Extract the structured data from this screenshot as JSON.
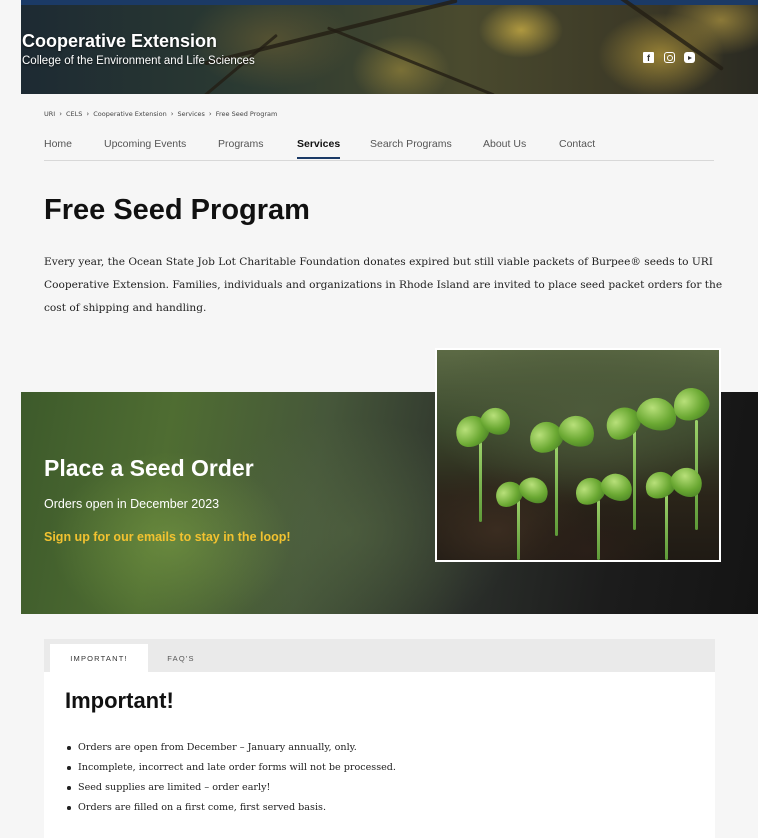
{
  "header": {
    "title": "Cooperative Extension",
    "subtitle": "College of the Environment and Life Sciences",
    "social_icons": [
      "facebook-icon",
      "instagram-icon",
      "youtube-icon"
    ]
  },
  "breadcrumb": [
    "URI",
    "CELS",
    "Cooperative Extension",
    "Services",
    "Free Seed Program"
  ],
  "nav": {
    "items": [
      "Home",
      "Upcoming Events",
      "Programs",
      "Services",
      "Search Programs",
      "About Us",
      "Contact"
    ],
    "active": "Services"
  },
  "page": {
    "title": "Free Seed Program",
    "intro": "Every year, the Ocean State Job Lot Charitable Foundation donates expired but still viable packets of Burpee® seeds to URI Cooperative Extension. Families, individuals and organizations in Rhode Island are invited to place seed packet orders for the cost of shipping and handling."
  },
  "seed_order": {
    "title": "Place a Seed Order",
    "subtitle": "Orders open in December 2023",
    "link": "Sign up for our emails to stay in the loop!"
  },
  "tabs": {
    "items": [
      "IMPORTANT!",
      "FAQ'S"
    ],
    "active": "IMPORTANT!",
    "panel_title": "Important!",
    "bullets": [
      "Orders are open from December – January annually, only.",
      "Incomplete, incorrect and late order forms will not be processed.",
      "Seed supplies are limited – order early!",
      "Orders are filled on a first come, first served basis."
    ]
  },
  "colors": {
    "brand_navy": "#1b3a66",
    "link_gold": "#f2c230"
  }
}
